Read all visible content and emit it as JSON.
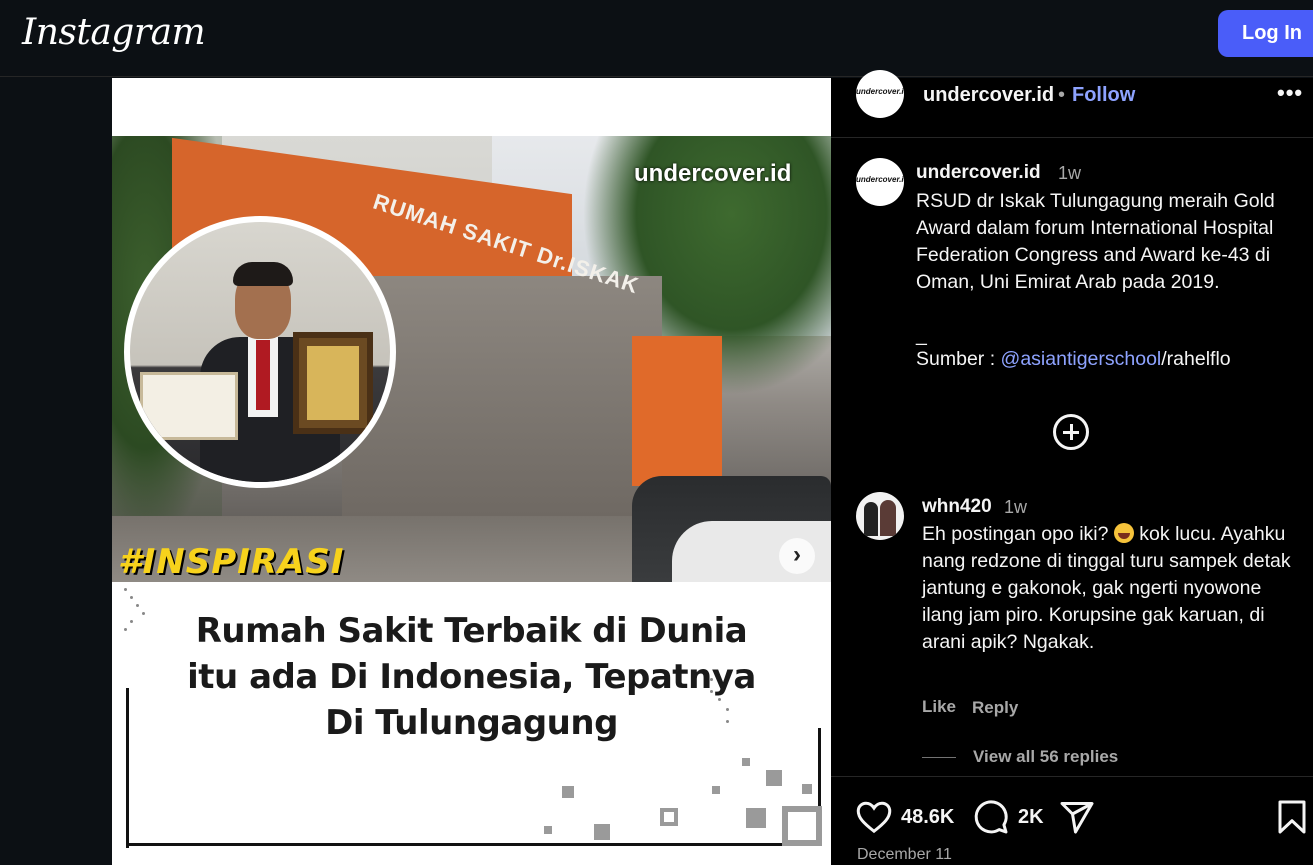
{
  "header": {
    "logo": "Instagram",
    "login_label": "Log In"
  },
  "post": {
    "image": {
      "watermark": "undercover.id",
      "sign_text": "RUMAH SAKIT Dr.ISKAK",
      "badge": "#INSPIRASI",
      "headline_lines": [
        "Rumah Sakit Terbaik di Dunia",
        "itu ada Di Indonesia, Tepatnya",
        "Di Tulungagung"
      ]
    },
    "author": {
      "username": "undercover.id",
      "avatar_text": "undercover.id",
      "separator": "•",
      "follow_label": "Follow",
      "more_label": "•••"
    },
    "caption": {
      "username": "undercover.id",
      "time": "1w",
      "text": "RSUD dr Iskak Tulungagung meraih Gold Award dalam forum International Hospital Federation Congress and Award ke-43 di Oman, Uni Emirat Arab pada 2019.",
      "dash": "_",
      "source_prefix": "Sumber : ",
      "source_mention": "@asiantigerschool",
      "source_suffix": "/rahelflo"
    },
    "comment": {
      "username": "whn420",
      "time": "1w",
      "text_before_emoji": "Eh postingan opo iki? ",
      "text_after_emoji": " kok lucu. Ayahku nang redzone di tinggal turu sampek detak jantung e gakonok, gak ngerti nyowone ilang jam piro. Korupsine gak karuan, di arani apik? Ngakak.",
      "like_label": "Like",
      "reply_label": "Reply",
      "view_replies_label": "View all 56 replies"
    },
    "actions": {
      "likes": "48.6K",
      "comments": "2K",
      "date": "December 11"
    }
  },
  "colors": {
    "background": "#0c1014",
    "accent_button": "#4a5df9",
    "link": "#8ea3ff",
    "badge": "#f7d21c"
  }
}
